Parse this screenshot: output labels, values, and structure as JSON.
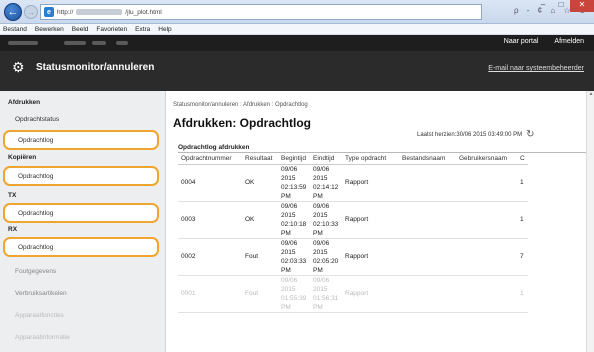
{
  "browser": {
    "address_prefix": "http://",
    "address_suffix": "/jlu_plot.html",
    "search_tools": "ρ - ¢ ⌂ ☆ ⚙",
    "menu": [
      "Bestand",
      "Bewerken",
      "Beeld",
      "Favorieten",
      "Extra",
      "Help"
    ],
    "win_min": "–",
    "win_max": "□",
    "win_close": "✕"
  },
  "header": {
    "portal_link": "Naar portal",
    "logout_link": "Afmelden",
    "title": "Statusmonitor/annuleren",
    "mail_link": "E-mail naar systeembeheerder"
  },
  "sidebar": {
    "sections": [
      {
        "heading": "Afdrukken",
        "items": [
          {
            "label": "Opdrachtstatus"
          },
          {
            "label": "Opdrachtlog",
            "highlighted": true
          }
        ]
      },
      {
        "heading": "Kopiëren",
        "items": [
          {
            "label": "Opdrachtlog",
            "highlighted": true
          }
        ]
      },
      {
        "heading": "TX",
        "items": [
          {
            "label": "Opdrachtlog",
            "highlighted": true
          }
        ]
      },
      {
        "heading": "RX",
        "items": [
          {
            "label": "Opdrachtlog",
            "highlighted": true
          }
        ]
      }
    ],
    "extra_items": [
      "Foutgegevens",
      "Verbruiksartikelen",
      "Apparaatfuncties",
      "Apparaatinformatie"
    ]
  },
  "main": {
    "breadcrumb": "Statusmonitor/annuleren : Afdrukken : Opdrachtlog",
    "title": "Afdrukken: Opdrachtlog",
    "last_updated": "Laatst herzien:30/06 2015 03:49:00 PM",
    "table_title": "Opdrachtlog afdrukken",
    "columns": [
      "Opdrachtnummer",
      "Resultaat",
      "Begintijd",
      "Eindtijd",
      "Type opdracht",
      "Bestandsnaam",
      "Gebruikersnaam",
      "C"
    ],
    "rows": [
      {
        "number": "0004",
        "result": "OK",
        "start": [
          "09/06",
          "2015",
          "02:13:59",
          "PM"
        ],
        "end": [
          "09/06",
          "2015",
          "02:14:12",
          "PM"
        ],
        "type": "Rapport",
        "file": "",
        "user": "",
        "count": "1"
      },
      {
        "number": "0003",
        "result": "OK",
        "start": [
          "09/06",
          "2015",
          "02:10:18",
          "PM"
        ],
        "end": [
          "09/06",
          "2015",
          "02:10:33",
          "PM"
        ],
        "type": "Rapport",
        "file": "",
        "user": "",
        "count": "1"
      },
      {
        "number": "0002",
        "result": "Fout",
        "start": [
          "09/06",
          "2015",
          "02:03:33",
          "PM"
        ],
        "end": [
          "09/06",
          "2015",
          "02:05:20",
          "PM"
        ],
        "type": "Rapport",
        "file": "",
        "user": "",
        "count": "7"
      },
      {
        "number": "0001",
        "result": "Fout",
        "start": [
          "09/06",
          "2015",
          "01:55:39",
          "PM"
        ],
        "end": [
          "09/06",
          "2015",
          "01:56:31",
          "PM"
        ],
        "type": "Rapport",
        "file": "",
        "user": "",
        "count": "1"
      }
    ]
  },
  "colors": {
    "highlight": "#f0a531",
    "header_bg": "#2b2b2b",
    "sidebar_bg": "#eceef0"
  }
}
